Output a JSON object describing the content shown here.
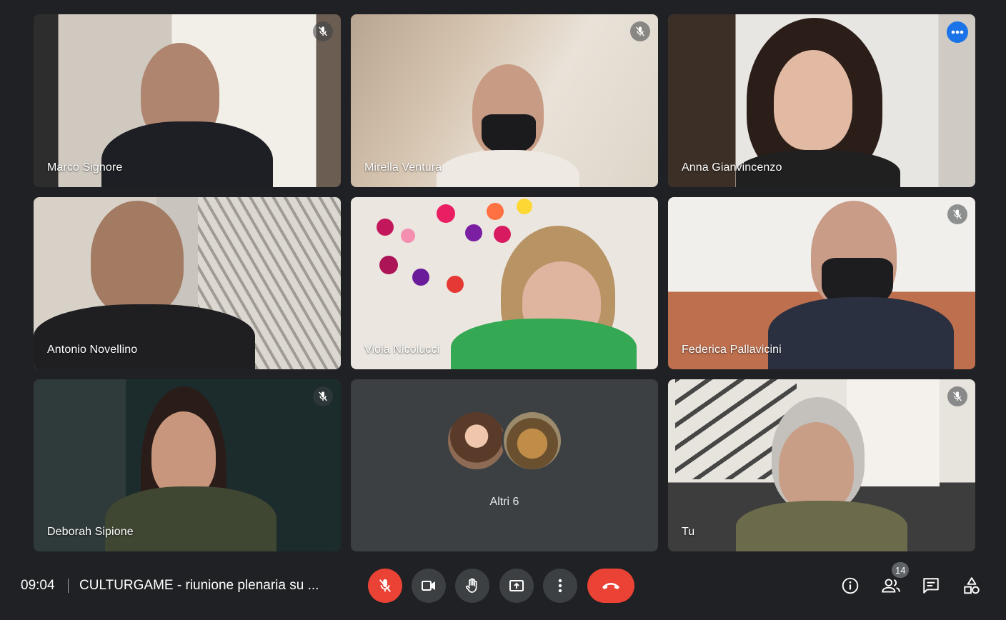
{
  "participants": [
    {
      "name": "Marco Signore",
      "muted": true
    },
    {
      "name": "Mirella Ventura",
      "muted": true
    },
    {
      "name": "Anna Gianvincenzo",
      "muted": false,
      "active_speaker": true
    },
    {
      "name": "Antonio Novellino",
      "muted": false
    },
    {
      "name": "Viola Nicolucci",
      "muted": false
    },
    {
      "name": "Federica Pallavicini",
      "muted": true
    },
    {
      "name": "Deborah Sipione",
      "muted": true
    },
    {
      "name": "Tu",
      "muted": true
    }
  ],
  "others_tile": {
    "label": "Altri 6"
  },
  "bottom_bar": {
    "time": "09:04",
    "meeting_title": "CULTURGAME - riunione plenaria su ...",
    "participants_count": "14"
  },
  "controls": [
    {
      "icon": "mic-off-icon",
      "state": "off"
    },
    {
      "icon": "videocam-icon"
    },
    {
      "icon": "raise-hand-icon"
    },
    {
      "icon": "present-screen-icon"
    },
    {
      "icon": "more-options-icon"
    },
    {
      "icon": "hang-up-icon"
    }
  ],
  "right_controls": [
    {
      "icon": "info-icon"
    },
    {
      "icon": "people-icon"
    },
    {
      "icon": "chat-icon"
    },
    {
      "icon": "activities-icon"
    }
  ],
  "colors": {
    "background": "#202124",
    "tile": "#3c4043",
    "accent_blue": "#1a73e8",
    "red": "#ea4335"
  }
}
